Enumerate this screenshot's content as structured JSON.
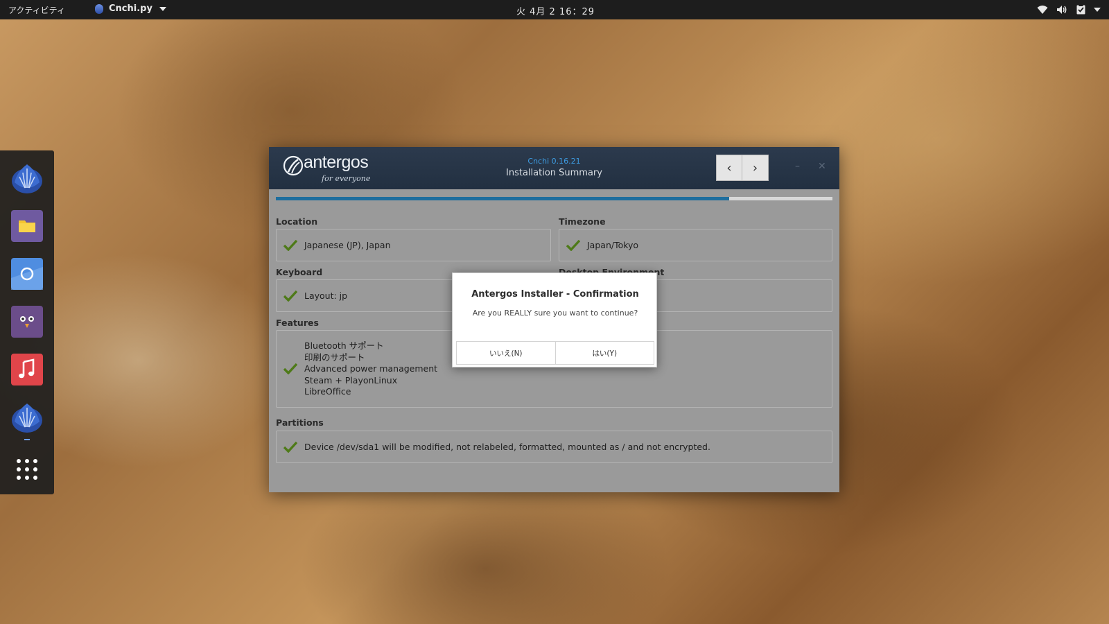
{
  "topbar": {
    "activities": "アクティビティ",
    "app_name": "Cnchi.py",
    "clock": "火 4月 2  16：29",
    "icons": [
      "wifi-icon",
      "volume-icon",
      "clipboard-icon",
      "chevron-down-icon"
    ]
  },
  "dock": {
    "items": [
      "antergos-icon",
      "files-icon",
      "chromium-icon",
      "pidgin-icon",
      "music-icon",
      "cnchi-icon",
      "app-grid-icon"
    ]
  },
  "window": {
    "logo_text": "antergos",
    "logo_tagline": "for everyone",
    "version": "Cnchi  0.16.21",
    "title": "Installation Summary",
    "back_symbol": "‹",
    "forward_symbol": "›",
    "minimize_symbol": "–",
    "close_symbol": "✕",
    "progress_fraction": 0.815
  },
  "summary": {
    "location": {
      "label": "Location",
      "value": "Japanese (JP), Japan"
    },
    "timezone": {
      "label": "Timezone",
      "value": "Japan/Tokyo"
    },
    "keyboard": {
      "label": "Keyboard",
      "value": "Layout: jp"
    },
    "desktop": {
      "label": "Desktop Environment",
      "value": ""
    },
    "features": {
      "label": "Features",
      "items": [
        "Bluetooth サポート",
        "印刷のサポート",
        "Advanced power management",
        "Steam + PlayonLinux",
        "LibreOffice"
      ]
    },
    "partitions": {
      "label": "Partitions",
      "value": "Device /dev/sda1 will be modified, not relabeled, formatted, mounted as / and not encrypted."
    }
  },
  "dialog": {
    "title": "Antergos Installer - Confirmation",
    "message": "Are you REALLY sure you want to continue?",
    "no_label": "いいえ(N)",
    "yes_label": "はい(Y)"
  },
  "colors": {
    "accent": "#1f6e9e",
    "check": "#4e7a18",
    "header": "#26344a"
  }
}
